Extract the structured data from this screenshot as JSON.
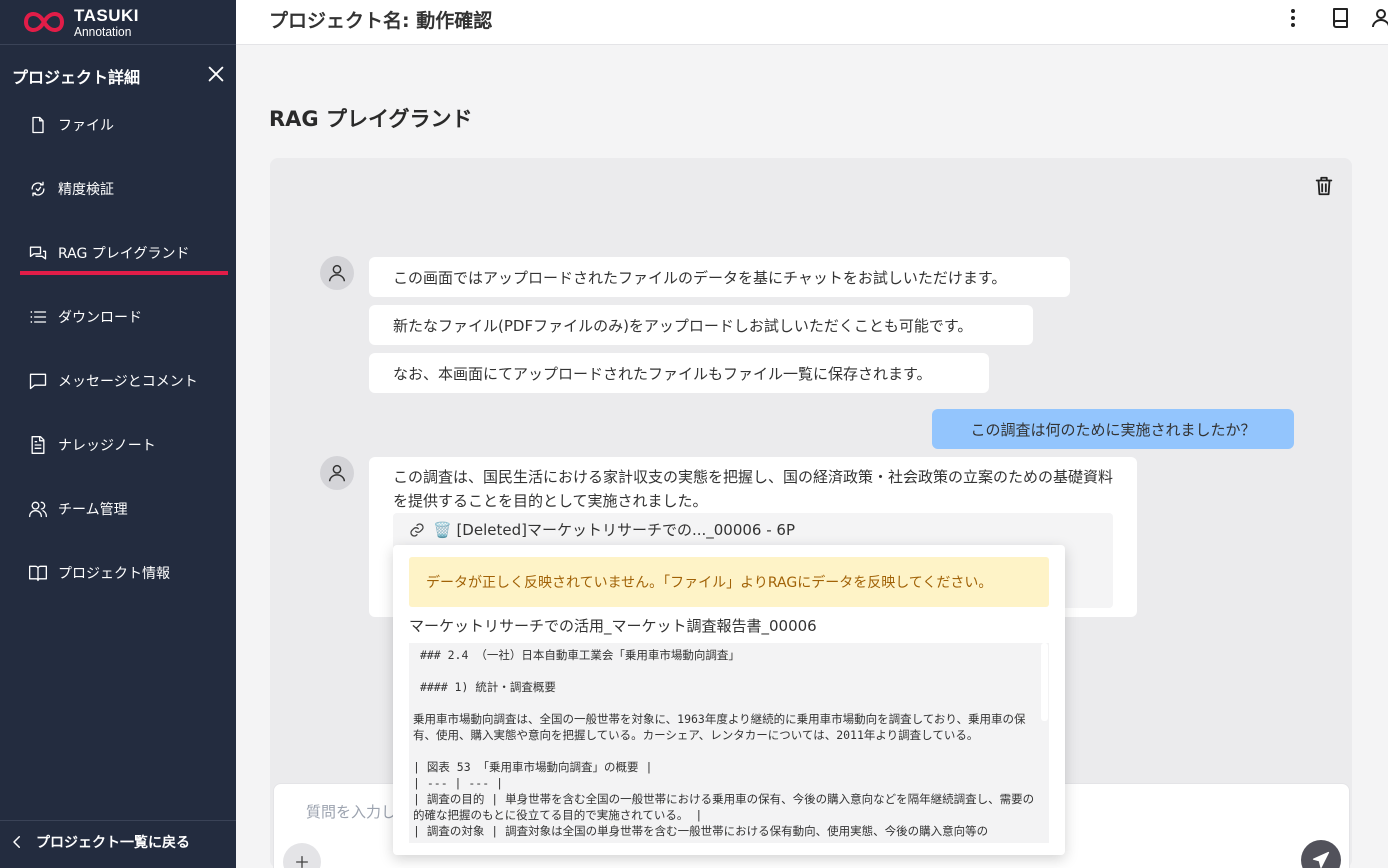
{
  "logo": {
    "name": "TASUKI",
    "sub": "Annotation"
  },
  "sidebar": {
    "title": "プロジェクト詳細",
    "items": [
      {
        "label": "ファイル",
        "icon": "file-icon"
      },
      {
        "label": "精度検証",
        "icon": "accuracy-icon"
      },
      {
        "label": "RAG プレイグランド",
        "icon": "chat-icon",
        "active": true
      },
      {
        "label": "ダウンロード",
        "icon": "list-icon"
      },
      {
        "label": "メッセージとコメント",
        "icon": "message-icon"
      },
      {
        "label": "ナレッジノート",
        "icon": "note-icon"
      },
      {
        "label": "チーム管理",
        "icon": "team-icon"
      },
      {
        "label": "プロジェクト情報",
        "icon": "book-icon"
      }
    ],
    "back_label": "プロジェクト一覧に戻る"
  },
  "header": {
    "project_name": "プロジェクト名: 動作確認"
  },
  "page": {
    "title": "RAG プレイグランド"
  },
  "chat": {
    "intro_messages": [
      "この画面ではアップロードされたファイルのデータを基にチャットをお試しいただけます。",
      "新たなファイル(PDFファイルのみ)をアップロードしお試しいただくことも可能です。",
      "なお、本画面にてアップロードされたファイルもファイル一覧に保存されます。"
    ],
    "user_question": "この調査は何のために実施されましたか？",
    "answer": "この調査は、国民生活における家計収支の実態を把握し、国の経済政策・社会政策の立案のための基礎資料を提供することを目的として実施されました。",
    "source_label": "🗑️ [Deleted]マーケットリサーチでの..._00006 - 6P"
  },
  "popover": {
    "warning": "データが正しく反映されていません。「ファイル」よりRAGにデータを反映してください。",
    "doc_title": "マーケットリサーチでの活用_マーケット調査報告書_00006",
    "content": " ### 2.4 （一社）日本自動車工業会「乗用車市場動向調査」\n\n #### 1) 統計・調査概要\n\n乗用車市場動向調査は、全国の一般世帯を対象に、1963年度より継続的に乗用車市場動向を調査しており、乗用車の保有、使用、購入実態や意向を把握している。カーシェア、レンタカーについては、2011年より調査している。\n\n| 図表 53 「乗用車市場動向調査」の概要 |\n| --- | --- |\n| 調査の目的 | 単身世帯を含む全国の一般世帯における乗用車の保有、今後の購入意向などを隔年継続調査し、需要の的確な把握のもとに役立てる目的で実施されている。 |\n| 調査の対象 | 調査対象は全国の単身世帯を含む一般世帯における保有動向、使用実態、今後の購入意向等の"
  },
  "input": {
    "placeholder": "質問を入力してください"
  }
}
